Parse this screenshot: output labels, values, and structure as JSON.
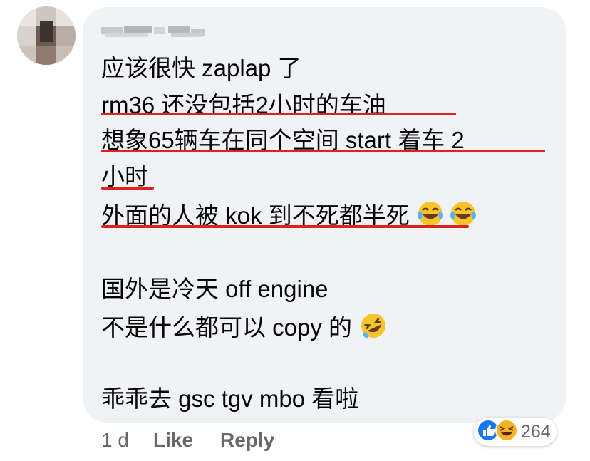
{
  "comment": {
    "lines": [
      "应该很快 zaplap 了",
      "rm36 还没包括2小时的车油",
      "想象65辆车在同个空间 start 着车 2",
      "小时",
      "外面的人被 kok 到不死都半死",
      "国外是冷天 off engine",
      "不是什么都可以 copy 的",
      "乖乖去 gsc tgv mbo 看啦"
    ],
    "emojis": [
      "face-with-tears-of-joy-icon",
      "rolling-on-the-floor-laughing-icon"
    ]
  },
  "footer": {
    "time": "1 d",
    "like_label": "Like",
    "reply_label": "Reply"
  },
  "reactions": {
    "count": "264",
    "types": [
      "like-icon",
      "haha-icon"
    ]
  },
  "colors": {
    "bubble": "#f0f2f5",
    "underline": "#e0221f",
    "meta_text": "#65676b",
    "like_blue": "#1877f2",
    "haha_yellow": "#f7b125"
  }
}
